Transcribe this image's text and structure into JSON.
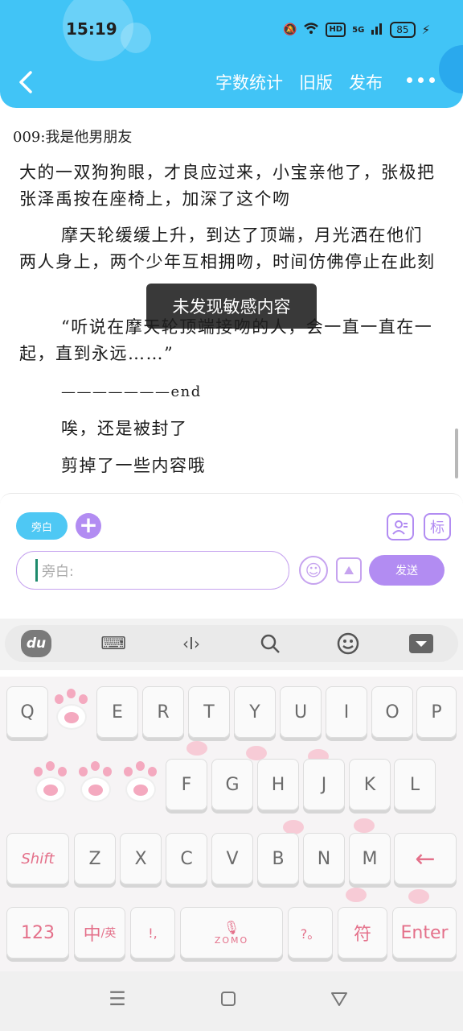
{
  "status_bar": {
    "time": "15:19",
    "hd": "HD",
    "net": "5G",
    "battery": "85"
  },
  "header": {
    "accent": "#41c4f6",
    "actions": {
      "word_count": "字数统计",
      "old_version": "旧版",
      "publish": "发布"
    }
  },
  "content": {
    "chapter_title": "009:我是他男朋友",
    "paragraphs": [
      "大的一双狗狗眼，才良应过来，小宝亲他了，张极把张泽禹按在座椅上，加深了这个吻",
      "摩天轮缓缓上升，到达了顶端，月光洒在他们两人身上，两个少年互相拥吻，时间仿佛停止在此刻",
      "“听说在摩天轮顶端接吻的人，会一直一直在一起，直到永远……”",
      "———————end",
      "唉，还是被封了",
      "剪掉了一些内容哦"
    ],
    "toast": "未发现敏感内容"
  },
  "input_panel": {
    "role_chip": "旁白",
    "tag_button": "标",
    "placeholder": "旁白:",
    "send": "发送",
    "accent": "#b28cf2"
  },
  "keyboard": {
    "row1": [
      "Q",
      "",
      "E",
      "R",
      "T",
      "Y",
      "U",
      "I",
      "O",
      "P"
    ],
    "row2": [
      "",
      "",
      "",
      "F",
      "G",
      "H",
      "J",
      "K",
      "L"
    ],
    "row3": [
      "Shift",
      "Z",
      "X",
      "C",
      "V",
      "B",
      "N",
      "M",
      "←"
    ],
    "row4": {
      "num": "123",
      "lang_main": "中",
      "lang_sub": "/英",
      "punct1": "!,",
      "brand": "ZOMO",
      "punct2": "?。",
      "symbol": "符",
      "enter": "Enter"
    },
    "toolbar_logo": "du"
  }
}
